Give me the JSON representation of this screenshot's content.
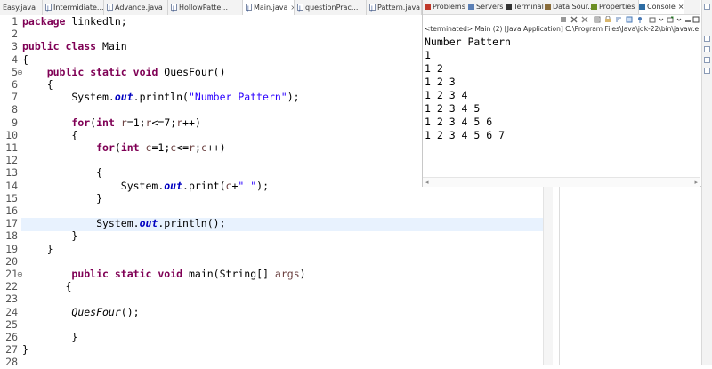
{
  "editor_tabs": [
    {
      "label": "Easy.java",
      "active": false
    },
    {
      "label": "Intermidiate...",
      "active": false
    },
    {
      "label": "Advance.java",
      "active": false
    },
    {
      "label": "HollowPatte...",
      "active": false
    },
    {
      "label": "Main.java",
      "active": true,
      "close": "×"
    },
    {
      "label": "questionPrac...",
      "active": false
    },
    {
      "label": "Pattern.java",
      "active": false
    }
  ],
  "code_lines": [
    {
      "n": "1",
      "fold": "",
      "html": "<span class=\"kw\">package</span> linkedln;"
    },
    {
      "n": "2",
      "fold": "",
      "html": ""
    },
    {
      "n": "3",
      "fold": "",
      "html": "<span class=\"kw\">public</span> <span class=\"kw\">class</span> Main"
    },
    {
      "n": "4",
      "fold": "",
      "html": "{"
    },
    {
      "n": "5",
      "fold": "⊖",
      "html": "    <span class=\"kw\">public</span> <span class=\"kw\">static</span> <span class=\"kw\">void</span> QuesFour()"
    },
    {
      "n": "6",
      "fold": "",
      "html": "    {"
    },
    {
      "n": "7",
      "fold": "",
      "html": "        System.<span class=\"fld\">out</span>.println(<span class=\"str\">\"Number Pattern\"</span>);"
    },
    {
      "n": "8",
      "fold": "",
      "html": ""
    },
    {
      "n": "9",
      "fold": "",
      "html": "        <span class=\"kw\">for</span>(<span class=\"kw\">int</span> <span class=\"var\">r</span>=1;<span class=\"var\">r</span>&lt;=7;<span class=\"var\">r</span>++)"
    },
    {
      "n": "10",
      "fold": "",
      "html": "        {"
    },
    {
      "n": "11",
      "fold": "",
      "html": "            <span class=\"kw\">for</span>(<span class=\"kw\">int</span> <span class=\"var\">c</span>=1;<span class=\"var\">c</span>&lt;=<span class=\"var\">r</span>;<span class=\"var\">c</span>++)"
    },
    {
      "n": "12",
      "fold": "",
      "html": ""
    },
    {
      "n": "13",
      "fold": "",
      "html": "            {"
    },
    {
      "n": "14",
      "fold": "",
      "html": "                System.<span class=\"fld\">out</span>.print(<span class=\"var\">c</span>+<span class=\"str\">\" \"</span>);"
    },
    {
      "n": "15",
      "fold": "",
      "html": "            }"
    },
    {
      "n": "16",
      "fold": "",
      "html": ""
    },
    {
      "n": "17",
      "fold": "",
      "html": "            System.<span class=\"fld\">out</span>.println();"
    },
    {
      "n": "18",
      "fold": "",
      "html": "        }"
    },
    {
      "n": "19",
      "fold": "",
      "html": "    }"
    },
    {
      "n": "20",
      "fold": "",
      "html": ""
    },
    {
      "n": "21",
      "fold": "⊖",
      "html": "        <span class=\"kw\">public</span> <span class=\"kw\">static</span> <span class=\"kw\">void</span> main(String[] <span class=\"par\">args</span>)"
    },
    {
      "n": "22",
      "fold": "",
      "html": "       {"
    },
    {
      "n": "23",
      "fold": "",
      "html": ""
    },
    {
      "n": "24",
      "fold": "",
      "html": "        <span class=\"itl\">QuesFour</span>();"
    },
    {
      "n": "25",
      "fold": "",
      "html": ""
    },
    {
      "n": "26",
      "fold": "",
      "html": "        }"
    },
    {
      "n": "27",
      "fold": "",
      "html": "}"
    },
    {
      "n": "28",
      "fold": "",
      "html": ""
    }
  ],
  "panel": {
    "tabs": [
      {
        "label": "Problems",
        "icon": "problems-icon",
        "color": "#c0392b"
      },
      {
        "label": "Servers",
        "icon": "servers-icon",
        "color": "#5b7fb5"
      },
      {
        "label": "Terminal",
        "icon": "terminal-icon",
        "color": "#333333"
      },
      {
        "label": "Data Sour...",
        "icon": "data-source-icon",
        "color": "#8a6d3b"
      },
      {
        "label": "Properties",
        "icon": "properties-icon",
        "color": "#6b8e23"
      },
      {
        "label": "Console",
        "icon": "console-icon",
        "color": "#2e6da4",
        "active": true,
        "close": "×"
      }
    ],
    "terminated": "<terminated> Main (2) [Java Application] C:\\Program Files\\Java\\jdk-22\\bin\\javaw.exe  (5 S",
    "console_output": [
      "Number Pattern",
      "1",
      "1 2",
      "1 2 3",
      "1 2 3 4",
      "1 2 3 4 5",
      "1 2 3 4 5 6",
      "1 2 3 4 5 6 7"
    ],
    "scroll_left": "◂",
    "scroll_right": "▸"
  }
}
